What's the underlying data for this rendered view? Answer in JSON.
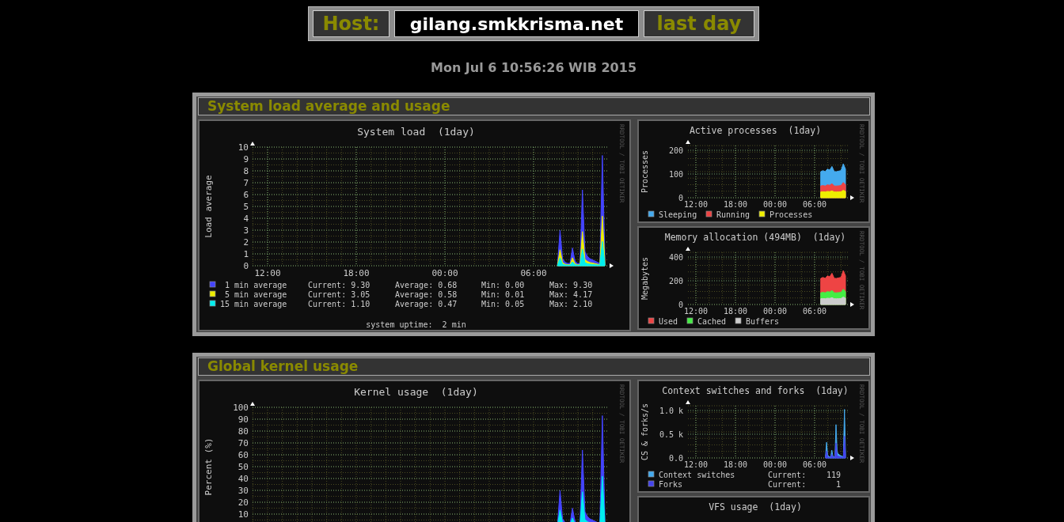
{
  "header": {
    "host_label": "Host:",
    "host": "gilang.smkkrisma.net",
    "period": "last day"
  },
  "date": "Mon Jul 6 10:56:26 WIB 2015",
  "sections": [
    {
      "title": "System load average and usage",
      "main": {
        "kind": "main",
        "title": "System load  (1day)",
        "ylabel": "Load average",
        "yticks": [
          "10",
          "9",
          "8",
          "7",
          "6",
          "5",
          "4",
          "3",
          "2",
          "1",
          "0"
        ],
        "xticks": [
          "12:00",
          "18:00",
          "00:00",
          "06:00"
        ],
        "watermark": "RRDTOOL / TOBI OETIKER",
        "legend": [
          {
            "color": "#4444ff",
            "label": " 1 min average",
            "stats": [
              "Current: 9.30",
              "Average: 0.68",
              "Min: 0.00",
              "Max: 9.30"
            ]
          },
          {
            "color": "#eeee00",
            "label": " 5 min average",
            "stats": [
              "Current: 3.05",
              "Average: 0.58",
              "Min: 0.01",
              "Max: 4.17"
            ]
          },
          {
            "color": "#00eeee",
            "label": "15 min average",
            "stats": [
              "Current: 1.10",
              "Average: 0.47",
              "Min: 0.05",
              "Max: 2.10"
            ]
          }
        ],
        "footer": "system uptime:  2 min"
      },
      "side": [
        {
          "kind": "side",
          "title": "Active processes  (1day)",
          "ylabel": "Processes",
          "yticks": [
            "200",
            "100",
            "0"
          ],
          "xticks": [
            "12:00",
            "18:00",
            "00:00",
            "06:00"
          ],
          "watermark": "RRDTOOL / TOBI OETIKER",
          "legend": [
            {
              "color": "#44aaee",
              "label": "Sleeping"
            },
            {
              "color": "#ee4444",
              "label": "Running"
            },
            {
              "color": "#eeee00",
              "label": "Processes"
            }
          ]
        },
        {
          "kind": "side",
          "title": "Memory allocation (494MB)  (1day)",
          "ylabel": "Megabytes",
          "yticks": [
            "400",
            "200",
            "0"
          ],
          "xticks": [
            "12:00",
            "18:00",
            "00:00",
            "06:00"
          ],
          "watermark": "RRDTOOL / TOBI OETIKER",
          "legend": [
            {
              "color": "#ee4444",
              "label": "Used"
            },
            {
              "color": "#44ee44",
              "label": "Cached"
            },
            {
              "color": "#cccccc",
              "label": "Buffers"
            }
          ]
        }
      ]
    },
    {
      "title": "Global kernel usage",
      "main": {
        "kind": "main",
        "title": "Kernel usage  (1day)",
        "ylabel": "Percent (%)",
        "yticks": [
          "100",
          "90",
          "80",
          "70",
          "60",
          "50",
          "40",
          "30",
          "20",
          "10"
        ],
        "watermark": "RRDTOOL / TOBI OETIKER"
      },
      "side": [
        {
          "kind": "side",
          "title": "Context switches and forks  (1day)",
          "ylabel": "CS & forks/s",
          "yticks": [
            "1.0 k",
            "0.5 k",
            "0.0"
          ],
          "xticks": [
            "12:00",
            "18:00",
            "00:00",
            "06:00"
          ],
          "watermark": "RRDTOOL / TOBI OETIKER",
          "legend": [
            {
              "color": "#44aaee",
              "label": "Context switches",
              "stats": [
                "Current:",
                "119"
              ]
            },
            {
              "color": "#4444ee",
              "label": "Forks",
              "stats": [
                "Current:",
                "1"
              ]
            }
          ]
        },
        {
          "kind": "side",
          "title": "VFS usage  (1day)"
        }
      ]
    }
  ]
}
